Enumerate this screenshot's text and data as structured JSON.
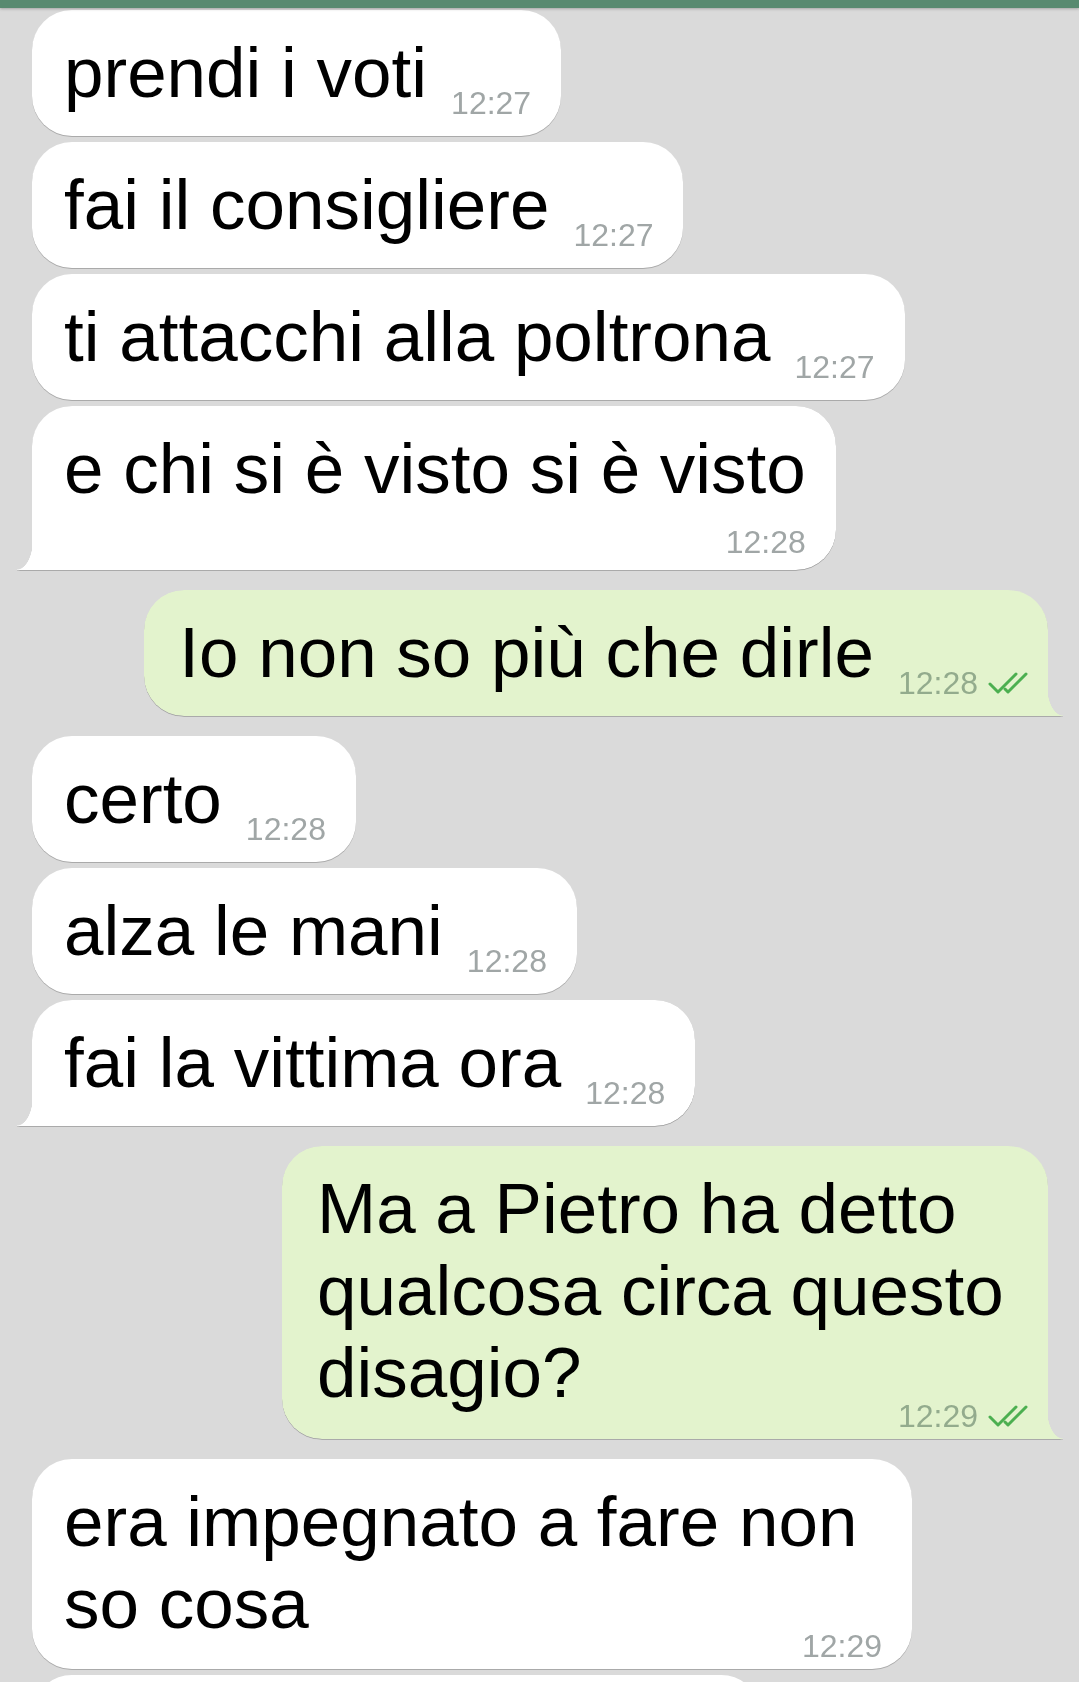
{
  "messages": [
    {
      "kind": "incoming",
      "text": "prendi i voti",
      "time": "12:27",
      "tail": false
    },
    {
      "kind": "incoming",
      "text": "fai il consigliere",
      "time": "12:27",
      "tail": false
    },
    {
      "kind": "incoming",
      "text": "ti attacchi alla poltrona",
      "time": "12:27",
      "tail": false
    },
    {
      "kind": "incoming",
      "text": "e chi si è visto si è visto",
      "time": "12:28",
      "tail": true
    },
    {
      "kind": "outgoing",
      "text": "Io non so più che dirle",
      "time": "12:28",
      "tail": true,
      "delivered": true
    },
    {
      "kind": "incoming",
      "text": "certo",
      "time": "12:28",
      "tail": false
    },
    {
      "kind": "incoming",
      "text": "alza le mani",
      "time": "12:28",
      "tail": false
    },
    {
      "kind": "incoming",
      "text": "fai la vittima ora",
      "time": "12:28",
      "tail": true
    },
    {
      "kind": "outgoing",
      "text": "Ma a Pietro ha detto qualcosa circa questo disagio?",
      "time": "12:29",
      "tail": true,
      "delivered": true
    },
    {
      "kind": "incoming",
      "text": "era impegnato a fare non so cosa",
      "time": "12:29",
      "tail": false
    },
    {
      "kind": "incoming"
    }
  ]
}
